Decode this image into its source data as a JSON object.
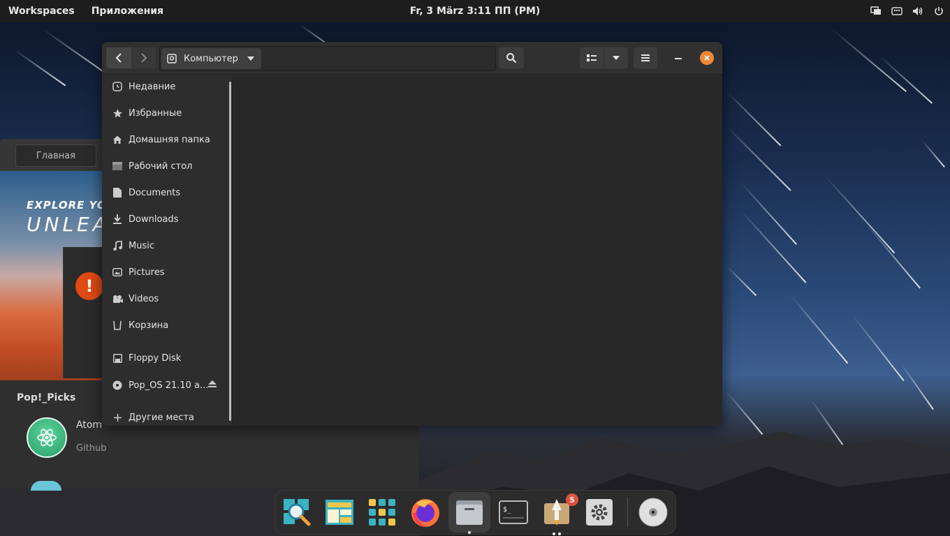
{
  "topbar": {
    "workspaces": "Workspaces",
    "applications": "Приложения",
    "clock": "Fr, 3 März   3:11 ПП (PM)",
    "tray_icons": [
      "display-icon",
      "keyboard-icon",
      "volume-icon",
      "power-icon"
    ]
  },
  "shop": {
    "home_tab": "Главная",
    "banner_line1": "EXPLORE YO",
    "banner_line2": "UNLEA",
    "picks_title": "Pop!_Picks",
    "app_name": "Atom",
    "app_dev": "Github"
  },
  "file_manager": {
    "path_crumb": "Компьютер",
    "sidebar": [
      {
        "label": "Недавние",
        "icon": "clock-icon"
      },
      {
        "label": "Избранные",
        "icon": "star-icon"
      },
      {
        "label": "Домашняя папка",
        "icon": "home-icon"
      },
      {
        "label": "Рабочий стол",
        "icon": "desktop-icon"
      },
      {
        "label": "Documents",
        "icon": "document-icon"
      },
      {
        "label": "Downloads",
        "icon": "download-icon"
      },
      {
        "label": "Music",
        "icon": "music-icon"
      },
      {
        "label": "Pictures",
        "icon": "picture-icon"
      },
      {
        "label": "Videos",
        "icon": "video-icon"
      },
      {
        "label": "Корзина",
        "icon": "trash-icon"
      },
      {
        "label": "Floppy Disk",
        "icon": "floppy-icon"
      },
      {
        "label": "Pop_OS 21.10 a...",
        "icon": "disc-icon"
      },
      {
        "label": "Другие места",
        "icon": "plus-icon"
      }
    ]
  },
  "dock": {
    "items": [
      "search-app",
      "files-panel-app",
      "app-grid",
      "firefox",
      "files",
      "terminal",
      "shop",
      "settings",
      "disc"
    ],
    "shop_badge": "5"
  },
  "colors": {
    "close_button": "#f0883a",
    "badge": "#e0523a",
    "warning": "#e04a14"
  }
}
